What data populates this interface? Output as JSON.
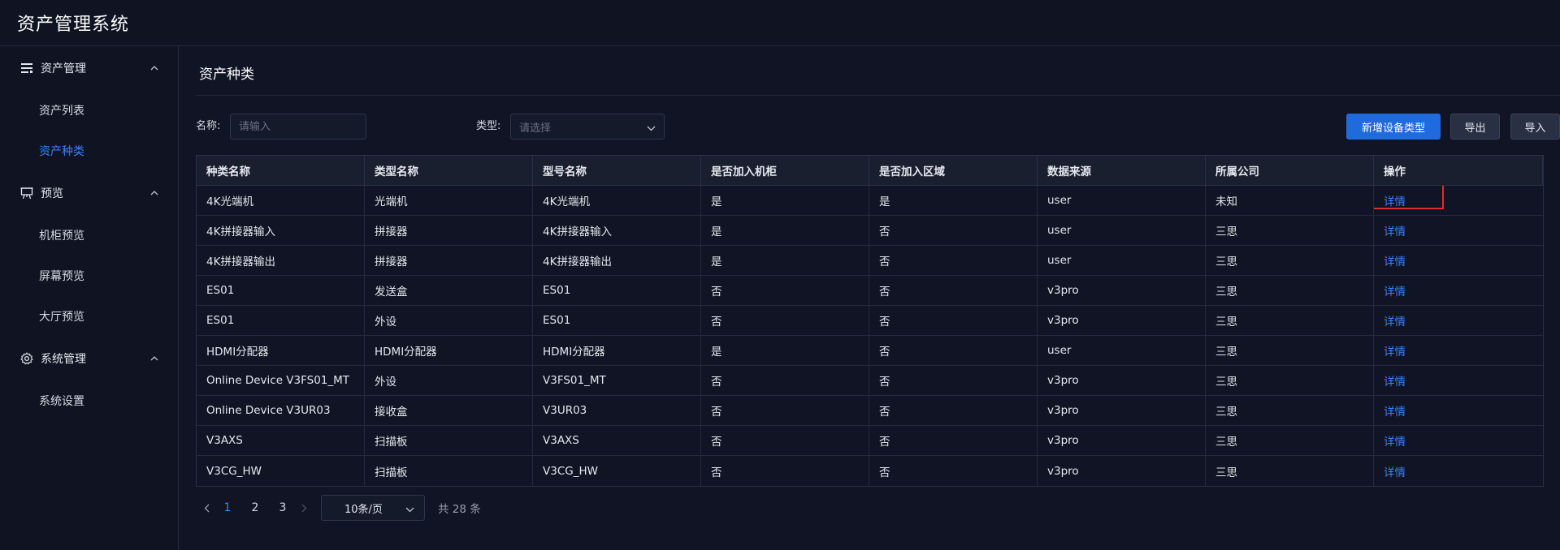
{
  "app": {
    "title": "资产管理系统"
  },
  "sidebar": {
    "groups": [
      {
        "label": "资产管理",
        "icon": "list-icon",
        "items": [
          {
            "label": "资产列表",
            "active": false
          },
          {
            "label": "资产种类",
            "active": true
          }
        ]
      },
      {
        "label": "预览",
        "icon": "easel-icon",
        "items": [
          {
            "label": "机柜预览",
            "active": false
          },
          {
            "label": "屏幕预览",
            "active": false
          },
          {
            "label": "大厅预览",
            "active": false
          }
        ]
      },
      {
        "label": "系统管理",
        "icon": "gear-icon",
        "items": [
          {
            "label": "系统设置",
            "active": false
          }
        ]
      }
    ]
  },
  "main": {
    "page_title": "资产种类",
    "filters": {
      "name_label": "名称:",
      "name_placeholder": "请输入",
      "type_label": "类型:",
      "type_placeholder": "请选择"
    },
    "buttons": {
      "add": "新增设备类型",
      "export": "导出",
      "import": "导入"
    },
    "table": {
      "columns": [
        "种类名称",
        "类型名称",
        "型号名称",
        "是否加入机柜",
        "是否加入区域",
        "数据来源",
        "所属公司",
        "操作"
      ],
      "rows": [
        [
          "4K光端机",
          "光端机",
          "4K光端机",
          "是",
          "是",
          "user",
          "未知",
          "详情"
        ],
        [
          "4K拼接器输入",
          "拼接器",
          "4K拼接器输入",
          "是",
          "否",
          "user",
          "三思",
          "详情"
        ],
        [
          "4K拼接器输出",
          "拼接器",
          "4K拼接器输出",
          "是",
          "否",
          "user",
          "三思",
          "详情"
        ],
        [
          "ES01",
          "发送盒",
          "ES01",
          "否",
          "否",
          "v3pro",
          "三思",
          "详情"
        ],
        [
          "ES01",
          "外设",
          "ES01",
          "否",
          "否",
          "v3pro",
          "三思",
          "详情"
        ],
        [
          "HDMI分配器",
          "HDMI分配器",
          "HDMI分配器",
          "是",
          "否",
          "user",
          "三思",
          "详情"
        ],
        [
          "Online Device V3FS01_MT",
          "外设",
          "V3FS01_MT",
          "否",
          "否",
          "v3pro",
          "三思",
          "详情"
        ],
        [
          "Online Device V3UR03",
          "接收盒",
          "V3UR03",
          "否",
          "否",
          "v3pro",
          "三思",
          "详情"
        ],
        [
          "V3AXS",
          "扫描板",
          "V3AXS",
          "否",
          "否",
          "v3pro",
          "三思",
          "详情"
        ],
        [
          "V3CG_HW",
          "扫描板",
          "V3CG_HW",
          "否",
          "否",
          "v3pro",
          "三思",
          "详情"
        ]
      ]
    },
    "pagination": {
      "pages": [
        "1",
        "2",
        "3"
      ],
      "current": "1",
      "page_size": "10条/页",
      "total": "共 28 条"
    }
  },
  "colors": {
    "accent": "#3b82f6",
    "primary_button": "#1f6bde",
    "highlight": "#e02d2d",
    "background": "#101424"
  }
}
